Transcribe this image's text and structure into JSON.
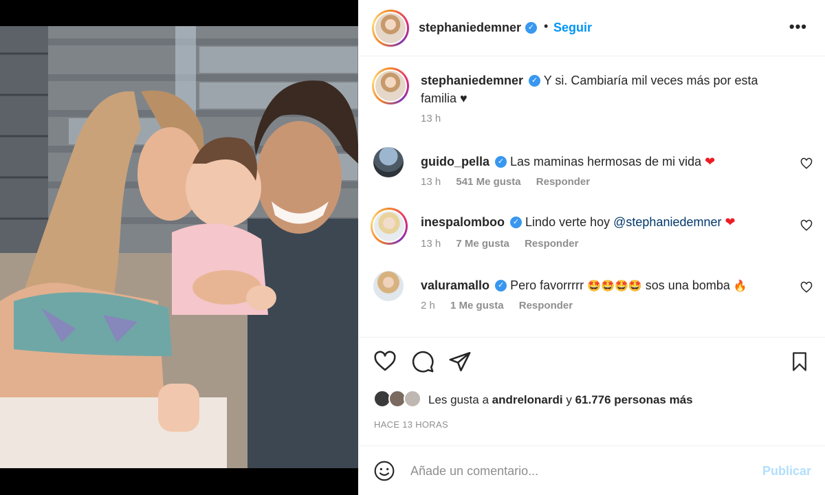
{
  "post": {
    "username": "stephaniedemner",
    "follow_label": "Seguir",
    "separator": "•",
    "more_label": "•••",
    "verified_mark": "✓"
  },
  "caption": {
    "username": "stephaniedemner",
    "text": "Y si. Cambiaría mil veces más por esta familia",
    "emoji": "♥",
    "time": "13 h"
  },
  "comments": [
    {
      "username": "guido_pella",
      "text": "Las maminas hermosas de mi vida",
      "emoji": "❤",
      "time": "13 h",
      "likes": "541 Me gusta",
      "reply": "Responder"
    },
    {
      "username": "inespalomboo",
      "text": "Lindo verte hoy",
      "mention": "@stephaniedemner",
      "emoji": "❤",
      "time": "13 h",
      "likes": "7 Me gusta",
      "reply": "Responder"
    },
    {
      "username": "valuramallo",
      "text": "Pero favorrrrr",
      "emoji_group": "🤩🤩🤩🤩",
      "text2": "sos una bomba",
      "emoji2": "🔥",
      "time": "2 h",
      "likes": "1 Me gusta",
      "reply": "Responder"
    }
  ],
  "likes": {
    "prefix": "Les gusta a",
    "user": "andrelonardi",
    "connector": "y",
    "count": "61.776 personas más"
  },
  "timestamp": "HACE 13 HORAS",
  "composer": {
    "placeholder": "Añade un comentario...",
    "publish_label": "Publicar"
  },
  "icons": {
    "like": "heart-icon",
    "comment": "comment-icon",
    "share": "share-icon",
    "save": "bookmark-icon",
    "emoji": "smiley-icon",
    "more": "more-icon"
  },
  "colors": {
    "link_blue": "#0095f6",
    "verified_blue": "#3897f0",
    "muted_gray": "#8e8e8e",
    "heart_red": "#ed1c24",
    "publish_disabled": "#b2dffc"
  }
}
